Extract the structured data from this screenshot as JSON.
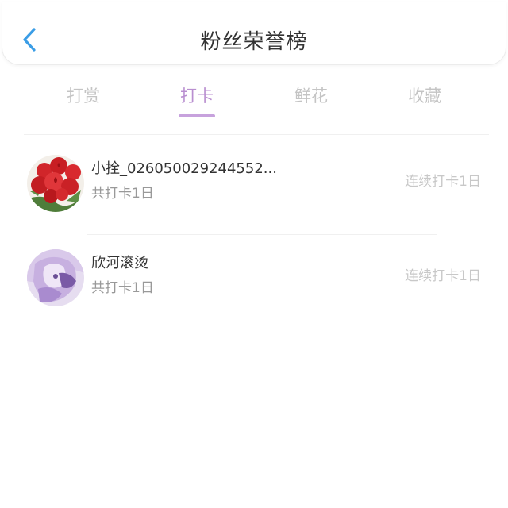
{
  "header": {
    "title": "粉丝荣誉榜",
    "back_icon": "chevron-left-icon",
    "accent": "#3a9de6"
  },
  "tabs": [
    {
      "label": "打赏",
      "active": false
    },
    {
      "label": "打卡",
      "active": true
    },
    {
      "label": "鲜花",
      "active": false
    },
    {
      "label": "收藏",
      "active": false
    }
  ],
  "colors": {
    "tab_active": "#b98fd0",
    "tab_inactive": "#c4c4c4"
  },
  "fans": [
    {
      "name": "小拴_026050029244552...",
      "total": "共打卡1日",
      "streak": "连续打卡1日",
      "avatar": "red-roses-avatar"
    },
    {
      "name": "欣河滚烫",
      "total": "共打卡1日",
      "streak": "连续打卡1日",
      "avatar": "anime-purple-avatar"
    }
  ]
}
